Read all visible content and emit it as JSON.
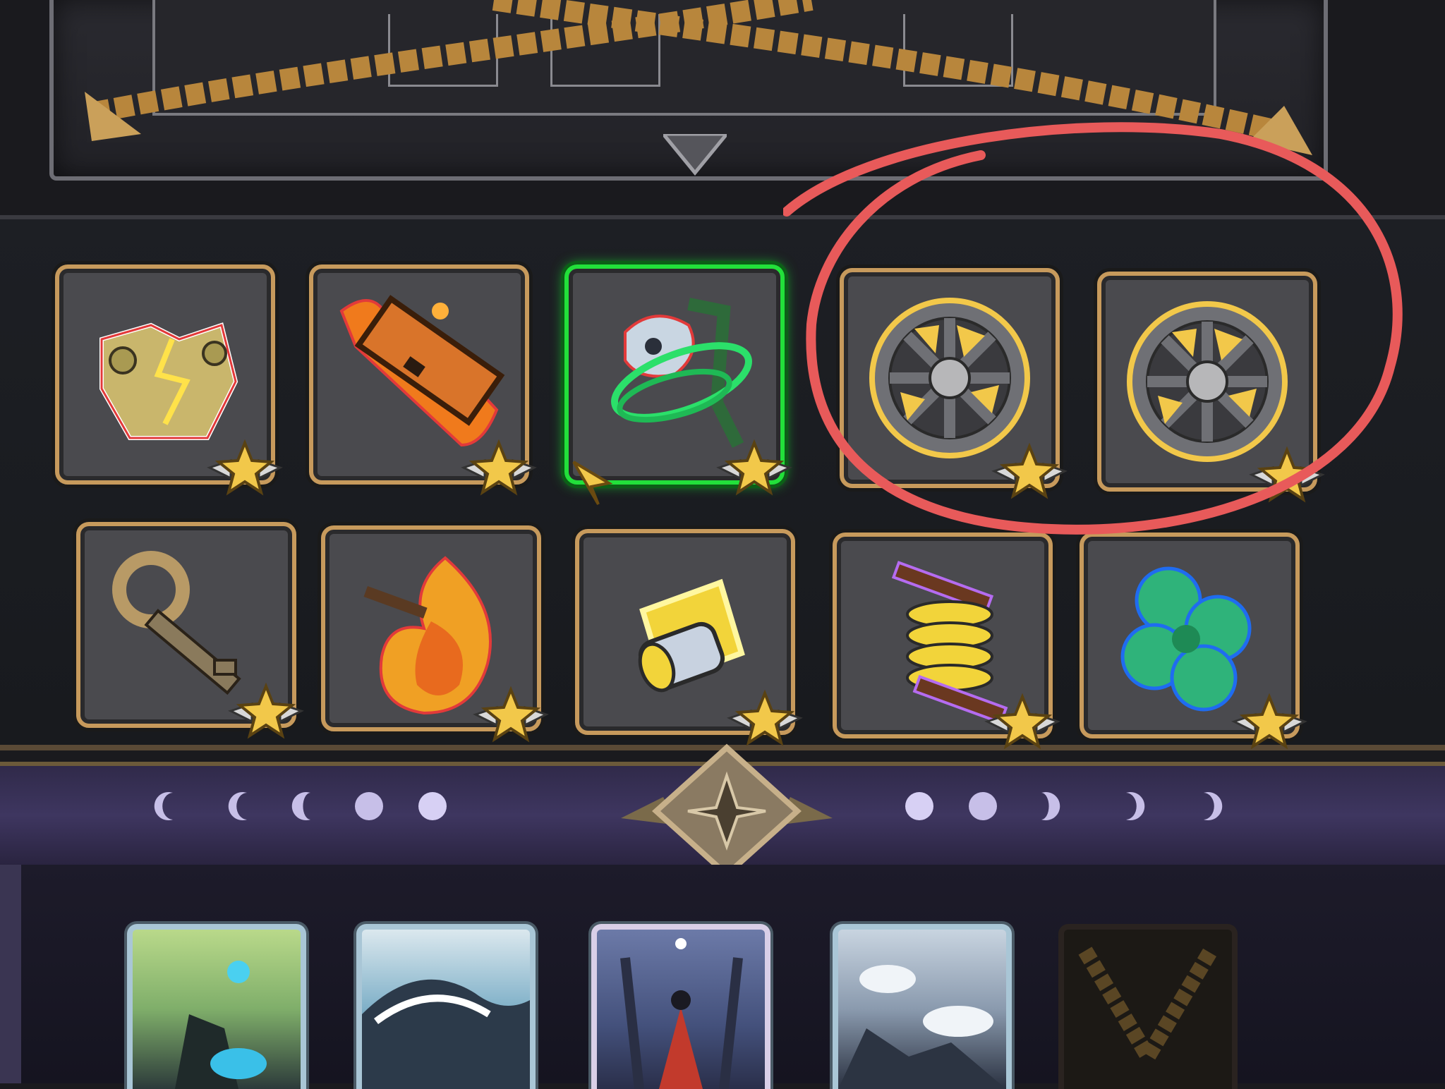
{
  "screen": {
    "annotation_color": "#e85a5a",
    "selected_border_color": "#22e03a",
    "slot_border_color": "#c79a5c"
  },
  "items": [
    {
      "name": "golden-armor-relic",
      "icon": "armor-lightning-icon",
      "rarity_stars": 1,
      "selected": false
    },
    {
      "name": "burning-plank-relic",
      "icon": "flaming-plank-icon",
      "rarity_stars": 1,
      "selected": false
    },
    {
      "name": "ghost-skull-relic",
      "icon": "wind-skull-icon",
      "rarity_stars": 1,
      "selected": true
    },
    {
      "name": "wagon-wheel-relic",
      "icon": "wagon-wheel-icon",
      "rarity_stars": 1,
      "selected": false,
      "circled": true
    },
    {
      "name": "wagon-wheel-relic",
      "icon": "wagon-wheel-icon",
      "rarity_stars": 1,
      "selected": false,
      "circled": true
    },
    {
      "name": "old-key-relic",
      "icon": "key-icon",
      "rarity_stars": 1,
      "selected": false
    },
    {
      "name": "fire-key-relic",
      "icon": "fire-icon",
      "rarity_stars": 1,
      "selected": false
    },
    {
      "name": "golden-cylinder-relic",
      "icon": "cylinder-icon",
      "rarity_stars": 1,
      "selected": false
    },
    {
      "name": "coil-spring-relic",
      "icon": "spring-icon",
      "rarity_stars": 1,
      "selected": false
    },
    {
      "name": "four-leaf-clover-relic",
      "icon": "clover-icon",
      "rarity_stars": 1,
      "selected": false
    }
  ],
  "moon_phases": [
    "crescent",
    "crescent",
    "crescent",
    "gibbous",
    "full",
    "full",
    "gibbous",
    "crescent",
    "crescent",
    "crescent"
  ],
  "cards": [
    {
      "name": "tarot-card-1",
      "theme": "forest"
    },
    {
      "name": "tarot-card-2",
      "theme": "wave"
    },
    {
      "name": "tarot-card-3",
      "theme": "red-cloak-figure"
    },
    {
      "name": "tarot-card-4",
      "theme": "storm"
    },
    {
      "name": "empty-card-slot",
      "theme": "empty"
    }
  ]
}
